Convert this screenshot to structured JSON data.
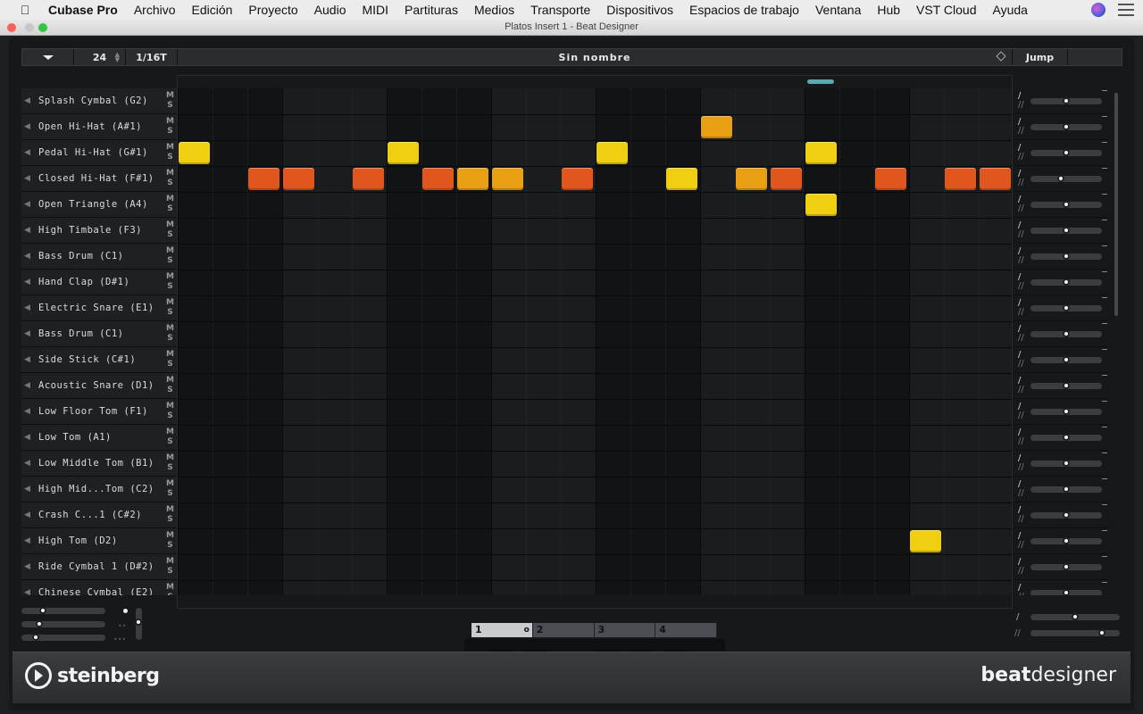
{
  "menubar": {
    "app_name": "Cubase Pro",
    "items": [
      "Archivo",
      "Edición",
      "Proyecto",
      "Audio",
      "MIDI",
      "Partituras",
      "Medios",
      "Transporte",
      "Dispositivos",
      "Espacios de trabajo",
      "Ventana",
      "Hub",
      "VST Cloud",
      "Ayuda"
    ]
  },
  "window": {
    "title": "Platos Insert 1 - Beat Designer"
  },
  "header": {
    "steps": "24",
    "resolution": "1/16T",
    "pattern_name": "Sin  nombre",
    "jump_label": "Jump"
  },
  "tracks": [
    {
      "name": "Splash Cymbal (G2)"
    },
    {
      "name": "Open Hi-Hat (A#1)"
    },
    {
      "name": "Pedal Hi-Hat (G#1)"
    },
    {
      "name": "Closed Hi-Hat (F#1)"
    },
    {
      "name": "Open Triangle (A4)"
    },
    {
      "name": "High Timbale (F3)"
    },
    {
      "name": "Bass Drum (C1)"
    },
    {
      "name": "Hand Clap (D#1)"
    },
    {
      "name": "Electric Snare (E1)"
    },
    {
      "name": "Bass Drum (C1)"
    },
    {
      "name": "Side Stick (C#1)"
    },
    {
      "name": "Acoustic Snare (D1)"
    },
    {
      "name": "Low Floor Tom (F1)"
    },
    {
      "name": "Low Tom (A1)"
    },
    {
      "name": "Low Middle Tom (B1)"
    },
    {
      "name": "High Mid...Tom (C2)"
    },
    {
      "name": "Crash C...1 (C#2)"
    },
    {
      "name": "High Tom (D2)"
    },
    {
      "name": "Ride Cymbal 1 (D#2)"
    },
    {
      "name": "Chinese Cymbal (E2)"
    }
  ],
  "mute_label": "M",
  "solo_label": "S",
  "steps": [
    {
      "row": 1,
      "col": 15,
      "level": "mid"
    },
    {
      "row": 2,
      "col": 0,
      "level": "soft"
    },
    {
      "row": 2,
      "col": 6,
      "level": "soft"
    },
    {
      "row": 2,
      "col": 12,
      "level": "soft"
    },
    {
      "row": 2,
      "col": 18,
      "level": "soft"
    },
    {
      "row": 3,
      "col": 2,
      "level": "loud"
    },
    {
      "row": 3,
      "col": 3,
      "level": "loud"
    },
    {
      "row": 3,
      "col": 5,
      "level": "loud"
    },
    {
      "row": 3,
      "col": 7,
      "level": "loud"
    },
    {
      "row": 3,
      "col": 8,
      "level": "mid"
    },
    {
      "row": 3,
      "col": 9,
      "level": "mid"
    },
    {
      "row": 3,
      "col": 11,
      "level": "loud"
    },
    {
      "row": 3,
      "col": 14,
      "level": "soft"
    },
    {
      "row": 3,
      "col": 16,
      "level": "mid"
    },
    {
      "row": 3,
      "col": 17,
      "level": "loud"
    },
    {
      "row": 3,
      "col": 20,
      "level": "loud"
    },
    {
      "row": 3,
      "col": 22,
      "level": "loud"
    },
    {
      "row": 3,
      "col": 23,
      "level": "loud"
    },
    {
      "row": 4,
      "col": 18,
      "level": "soft"
    },
    {
      "row": 17,
      "col": 21,
      "level": "soft"
    }
  ],
  "level_colors": {
    "soft": "#f0cf10",
    "mid": "#e8a012",
    "loud": "#e0561c"
  },
  "patterns": [
    {
      "label": "1",
      "active": true
    },
    {
      "label": "2",
      "active": false
    },
    {
      "label": "3",
      "active": false
    },
    {
      "label": "4",
      "active": false
    }
  ],
  "footer": {
    "brand": "steinberg",
    "product_bold": "beat",
    "product_light": "designer"
  }
}
